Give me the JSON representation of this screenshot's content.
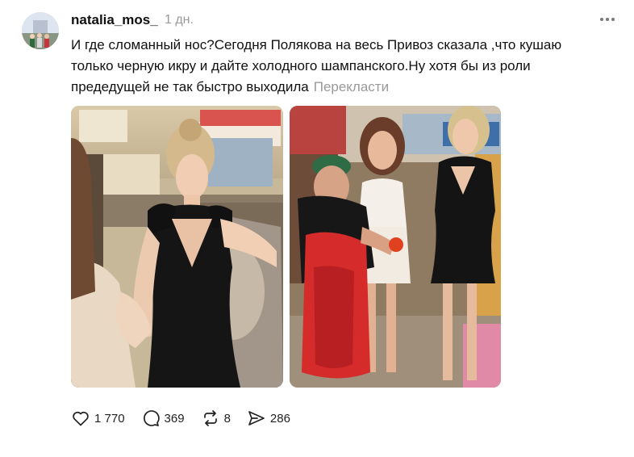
{
  "post": {
    "username": "natalia_mos_",
    "time": "1 дн.",
    "text_line1": "И где сломанный нос?Сегодня Полякова на весь Привоз сказала ,что кушаю",
    "text_line2": "только черную икру и дайте холодного шампанского.Ну хотя бы из роли",
    "text_line3": "предедущей не так быстро выходила",
    "translate_label": "Перекласти"
  },
  "media": [
    {
      "icon": "photo-woman-black-dress-at-counter"
    },
    {
      "icon": "photo-women-at-market-stall"
    }
  ],
  "actions": {
    "likes": "1 770",
    "replies": "369",
    "reposts": "8",
    "shares": "286"
  },
  "icons": {
    "more": "more-horizontal-icon",
    "like": "heart-icon",
    "reply": "comment-bubble-icon",
    "repost": "repost-arrows-icon",
    "share": "send-icon"
  },
  "colors": {
    "text": "#111111",
    "muted": "#9a9a9a",
    "background": "#ffffff"
  }
}
